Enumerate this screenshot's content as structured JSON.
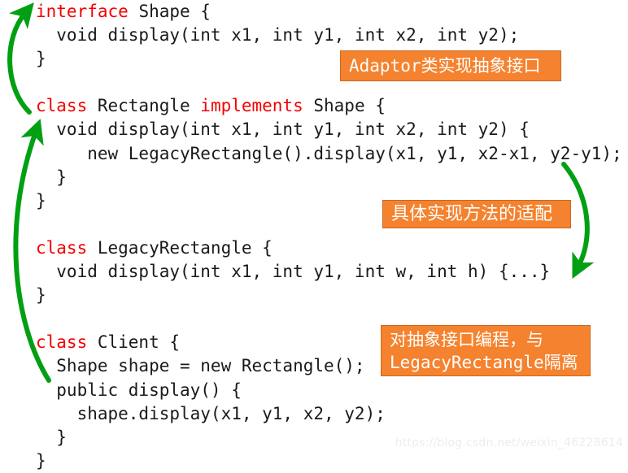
{
  "colors": {
    "background": "#ffffff",
    "code_text": "#1a1a1a",
    "keyword_red": "#f40000",
    "callout_orange": "#f5822e",
    "callout_border": "#c86a22",
    "callout_text": "#ffffff",
    "arrow_green": "#00a012",
    "watermark_gray": "#ededed"
  },
  "code": {
    "language": "java",
    "lines": [
      {
        "id": "line-1",
        "indent": 0,
        "segments": [
          {
            "t": "interface",
            "c": "kw"
          },
          {
            "t": " Shape {",
            "c": ""
          }
        ]
      },
      {
        "id": "line-2",
        "indent": 0,
        "segments": [
          {
            "t": "  void display(int x1, int y1, int x2, int y2);",
            "c": ""
          }
        ]
      },
      {
        "id": "line-3",
        "indent": 0,
        "segments": [
          {
            "t": "}",
            "c": ""
          }
        ]
      },
      {
        "id": "line-4",
        "indent": 0,
        "segments": [
          {
            "t": "",
            "c": ""
          }
        ]
      },
      {
        "id": "line-5",
        "indent": 0,
        "segments": [
          {
            "t": "class",
            "c": "kw"
          },
          {
            "t": " Rectangle ",
            "c": ""
          },
          {
            "t": "implements",
            "c": "kw"
          },
          {
            "t": " Shape {",
            "c": ""
          }
        ]
      },
      {
        "id": "line-6",
        "indent": 0,
        "segments": [
          {
            "t": "  void display(int x1, int y1, int x2, int y2) {",
            "c": ""
          }
        ]
      },
      {
        "id": "line-7",
        "indent": 0,
        "segments": [
          {
            "t": "     new LegacyRectangle().display(x1, y1, x2-x1, y2-y1);",
            "c": ""
          }
        ]
      },
      {
        "id": "line-8",
        "indent": 0,
        "segments": [
          {
            "t": "  }",
            "c": ""
          }
        ]
      },
      {
        "id": "line-9",
        "indent": 0,
        "segments": [
          {
            "t": "}",
            "c": ""
          }
        ]
      },
      {
        "id": "line-10",
        "indent": 0,
        "segments": [
          {
            "t": "",
            "c": ""
          }
        ]
      },
      {
        "id": "line-11",
        "indent": 0,
        "segments": [
          {
            "t": "class",
            "c": "kw"
          },
          {
            "t": " LegacyRectangle {",
            "c": ""
          }
        ]
      },
      {
        "id": "line-12",
        "indent": 0,
        "segments": [
          {
            "t": "  void display(int x1, int y1, int w, int h) {...}",
            "c": ""
          }
        ]
      },
      {
        "id": "line-13",
        "indent": 0,
        "segments": [
          {
            "t": "}",
            "c": ""
          }
        ]
      },
      {
        "id": "line-14",
        "indent": 0,
        "segments": [
          {
            "t": "",
            "c": ""
          }
        ]
      },
      {
        "id": "line-15",
        "indent": 0,
        "segments": [
          {
            "t": "class",
            "c": "kw"
          },
          {
            "t": " Client {",
            "c": ""
          }
        ]
      },
      {
        "id": "line-16",
        "indent": 0,
        "segments": [
          {
            "t": "  Shape shape = new Rectangle();",
            "c": ""
          }
        ]
      },
      {
        "id": "line-17",
        "indent": 0,
        "segments": [
          {
            "t": "  public display() {",
            "c": ""
          }
        ]
      },
      {
        "id": "line-18",
        "indent": 0,
        "segments": [
          {
            "t": "    shape.display(x1, y1, x2, y2);",
            "c": ""
          }
        ]
      },
      {
        "id": "line-19",
        "indent": 0,
        "segments": [
          {
            "t": "  }",
            "c": ""
          }
        ]
      },
      {
        "id": "line-20",
        "indent": 0,
        "segments": [
          {
            "t": "}",
            "c": ""
          }
        ]
      }
    ]
  },
  "callouts": {
    "adaptor": {
      "lines": [
        "Adaptor类实现抽象接口"
      ],
      "font": "mono"
    },
    "method": {
      "lines": [
        "具体实现方法的适配"
      ],
      "font": "serif"
    },
    "client": {
      "lines": [
        "对抽象接口编程，与",
        "LegacyRectangle隔离"
      ],
      "font": "mono"
    }
  },
  "arrows": [
    {
      "id": "arrow-interface-up",
      "direction": "up",
      "description": "curved arrow from class Rectangle region up to interface Shape"
    },
    {
      "id": "arrow-client-to-rectangle",
      "direction": "up",
      "description": "long curved arrow from Client up to Rectangle display"
    },
    {
      "id": "arrow-method-adapt",
      "direction": "down",
      "description": "curved arrow from 具体实现方法的适配 box down to LegacyRectangle display"
    }
  ],
  "watermark": {
    "text": "https://blog.csdn.net/weixin_46228614"
  }
}
